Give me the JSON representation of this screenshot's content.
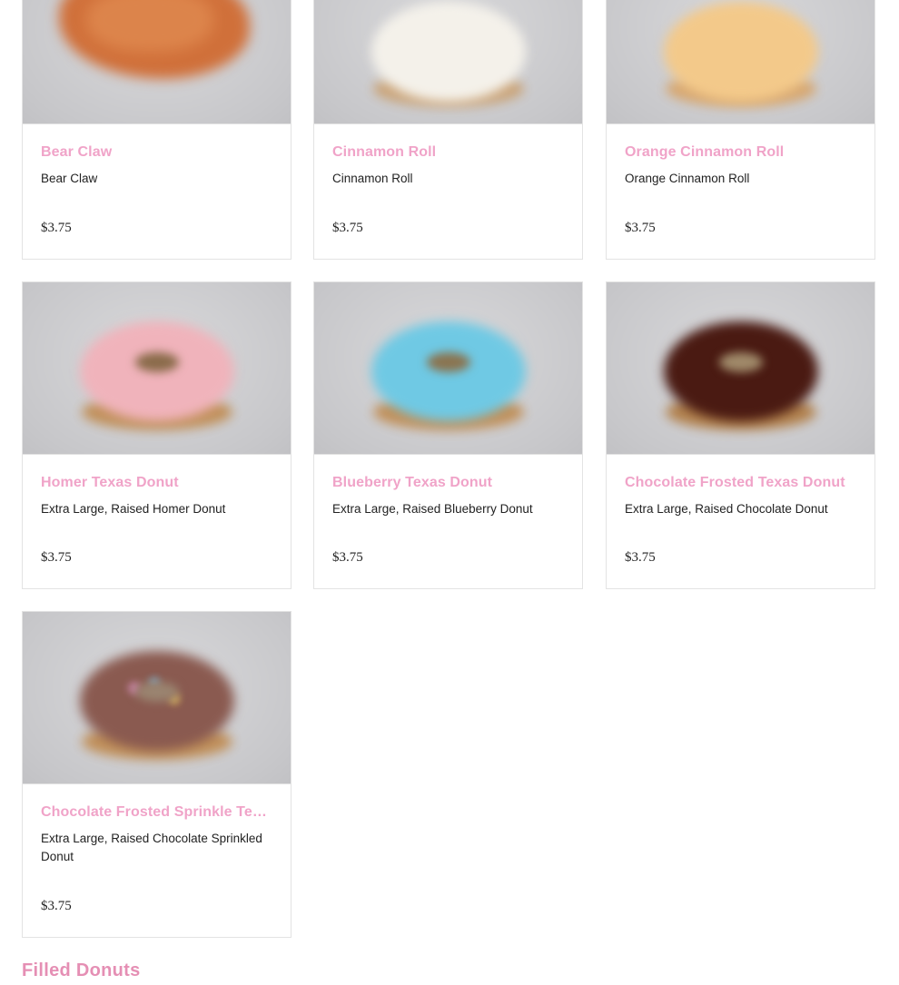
{
  "items": [
    {
      "name": "Bear Claw",
      "description": "Bear Claw",
      "price": "$3.75",
      "image": "bear-claw",
      "color": "#d0703a"
    },
    {
      "name": "Cinnamon Roll",
      "description": "Cinnamon Roll",
      "price": "$3.75",
      "image": "cinnamon-roll",
      "color": "#f4f1ea"
    },
    {
      "name": "Orange Cinnamon Roll",
      "description": "Orange Cinnamon Roll",
      "price": "$3.75",
      "image": "orange-cinnamon-roll",
      "color": "#f3c98a"
    },
    {
      "name": "Homer Texas Donut",
      "description": "Extra Large, Raised Homer Donut",
      "price": "$3.75",
      "image": "homer-donut",
      "color": "#f0b3bb"
    },
    {
      "name": "Blueberry Texas Donut",
      "description": "Extra Large, Raised Blueberry Donut",
      "price": "$3.75",
      "image": "blueberry-donut",
      "color": "#6fc9e4"
    },
    {
      "name": "Chocolate Frosted Texas Donut",
      "description": "Extra Large, Raised Chocolate Donut",
      "price": "$3.75",
      "image": "chocolate-donut",
      "color": "#4a1a12"
    },
    {
      "name": "Chocolate Frosted Sprinkle Tex...",
      "description": "Extra Large, Raised Chocolate Sprinkled Donut",
      "price": "$3.75",
      "image": "chocolate-sprinkle-donut",
      "color": "#8a5a50"
    }
  ],
  "section_title": "Filled Donuts"
}
